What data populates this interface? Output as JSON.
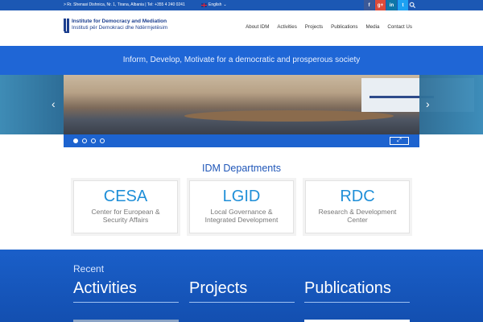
{
  "topbar": {
    "address": "> Rr. Shenasi Dishnica, Nr. 1, Tirana, Albania | Tel: +355 4 240 0241",
    "language": "English",
    "social": [
      "f",
      "g+",
      "in",
      "t"
    ]
  },
  "logo": {
    "line1": "Institute for Democracy and Mediation",
    "line2": "Instituti për Demokraci dhe Ndërmjetësim"
  },
  "nav": {
    "items": [
      "About IDM",
      "Activities",
      "Projects",
      "Publications",
      "Media",
      "Contact Us"
    ]
  },
  "banner": {
    "tagline": "Inform, Develop, Motivate for a democratic and prosperous society"
  },
  "slider": {
    "slide_count": 4,
    "active_slide": 1,
    "prev_arrow": "‹",
    "next_arrow": "›"
  },
  "departments": {
    "title": "IDM Departments",
    "items": [
      {
        "code": "CESA",
        "name": "Center for European & Security Affairs"
      },
      {
        "code": "LGID",
        "name": "Local Governance & Integrated Development"
      },
      {
        "code": "RDC",
        "name": "Research & Development Center"
      }
    ]
  },
  "recent": {
    "label": "Recent",
    "columns": [
      "Activities",
      "Projects",
      "Publications"
    ]
  },
  "colors": {
    "primary": "#1f66d6",
    "topbar": "#1c58b4",
    "accent": "#1f8fd8",
    "facebook": "#3b5998",
    "googleplus": "#dd4b39",
    "linkedin": "#0e76a8",
    "twitter": "#1da1f2"
  }
}
